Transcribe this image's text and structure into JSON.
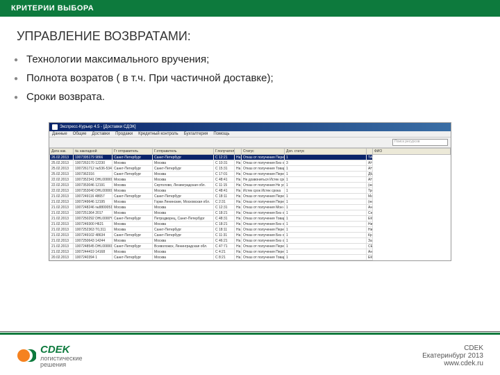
{
  "header": "КРИТЕРИИ ВЫБОРА",
  "title": "УПРАВЛЕНИЕ ВОЗВРАТАМИ:",
  "bullets": [
    "Технологии максимального вручения;",
    "Полнота возратов ( в т.ч. При частичной доставке);",
    "Сроки возврата."
  ],
  "app": {
    "title": "Экспресс-Курьер 4.5 - [Доставки СДЭК]",
    "menu": [
      "Данные",
      "Общие",
      "Доставки",
      "Продажи",
      "Кредитный контроль",
      "Бухгалтерия",
      "Помощь"
    ],
    "search_placeholder": "Поиск ресурсов"
  },
  "columns": [
    "Дата нак.",
    "№ накладной",
    "Гг отправитель",
    "Г.отправитель",
    "Г.получатель",
    "",
    "",
    "Статус",
    "Доп. статус",
    "",
    "ФИО"
  ],
  "rows": [
    {
      "date": "26.02.2013",
      "nak": "1007395179 9866",
      "otpr": "Санкт-Петербург",
      "pol": "Санкт-Петербург",
      "t": "С 12:21",
      "n": "1",
      "status": "На время, возврат",
      "dop": "Отказ от получения Перевклад",
      "n2": "1",
      "fio": "ТАТЬЯНА",
      "sel": true
    },
    {
      "date": "25.02.2013",
      "nak": "1007263170 12230",
      "otpr": "Москва",
      "pol": "Москва",
      "t": "С 10:31",
      "n": "1",
      "status": "На время, возврат",
      "dop": "Отказ от получения Без объяснения",
      "n2": "3",
      "fio": "АНДРЕЙ"
    },
    {
      "date": "25.02.2013",
      "nak": "1007261712 №536-534",
      "otpr": "Санкт-Петербург",
      "pol": "Санкт-Петербург",
      "t": "С 15:31",
      "n": "1",
      "status": "На время, возврат",
      "dop": "Отказ от получения Товар не подошел/не понравился",
      "n2": "1",
      "fio": "АНДРЕЙ"
    },
    {
      "date": "25.02.2013",
      "nak": "1007362316",
      "otpr": "Санкт-Петербург",
      "pol": "Москва",
      "t": "С 17:01",
      "n": "1",
      "status": "На время, возврат",
      "dop": "Отказ от получения Переадресат",
      "n2": "1",
      "fio": "ДМИТРИЙ"
    },
    {
      "date": "22.02.2013",
      "nak": "1007352341 DHL0000058",
      "otpr": "Москва",
      "pol": "Москва",
      "t": "С 48:41",
      "n": "1",
      "status": "На время, возврат",
      "dop": "Не дозвониться Истек срока",
      "n2": "1",
      "fio": "АНДРЕЙ"
    },
    {
      "date": "22.02.2013",
      "nak": "1007353046 12191",
      "otpr": "Москва",
      "pol": "Сертолово, Ленинградская обл.",
      "t": "С 11:15",
      "n": "1",
      "status": "На время, возврат",
      "dop": "Отказ от получения Не устроили сроки",
      "n2": "1",
      "fio": "(неуказано)"
    },
    {
      "date": "22.02.2013",
      "nak": "1007353040 DHL0000060",
      "otpr": "Москва",
      "pol": "Москва",
      "t": "С 48:41",
      "n": "1",
      "status": "На время, возврат",
      "dop": "Истек срок Истек срока",
      "n2": "1",
      "fio": "Трофим Вл."
    },
    {
      "date": "21.02.2013",
      "nak": "1007249116 48657",
      "otpr": "Санкт-Петербург",
      "pol": "Санкт-Петербург",
      "t": "С 18:11",
      "n": "1",
      "status": "На время, возврат",
      "dop": "Отказ от получения Переадресат",
      "n2": "1",
      "fio": "Мария Ша"
    },
    {
      "date": "21.02.2013",
      "nak": "1007249646 12195",
      "otpr": "Москва",
      "pol": "Горки Ленинские, Московская обл.",
      "t": "С 2:31",
      "n": "1",
      "status": "На время, возврат",
      "dop": "Отказ от получения Переадресат",
      "n2": "1",
      "fio": "(неуказано)"
    },
    {
      "date": "21.02.2013",
      "nak": "1007248246 №880005150",
      "otpr": "Москва",
      "pol": "Москва",
      "t": "С 12:31",
      "n": "1",
      "status": "На время, возврат",
      "dop": "Отказ от получения Мои суток",
      "n2": "1",
      "fio": "Андрей Ба"
    },
    {
      "date": "21.02.2013",
      "nak": "1007251364 2017",
      "otpr": "Москва",
      "pol": "Москва",
      "t": "С 18:21",
      "n": "1",
      "status": "На время, возврат",
      "dop": "Отказ от получения Без объяснения",
      "n2": "1",
      "fio": "Сергей Ка"
    },
    {
      "date": "21.02.2013",
      "nak": "1007250292 DHL0000*094",
      "otpr": "Санкт-Петербург",
      "pol": "Петродворец, Санкт-Петербург",
      "t": "С 48:31",
      "n": "1",
      "status": "На время, возврат",
      "dop": "Отказ от получения Товар не подошел/не понравился",
      "n2": "1",
      "fio": "ЕКСЕН"
    },
    {
      "date": "21.02.2013",
      "nak": "1007249300 Н621",
      "otpr": "Москва",
      "pol": "Москва",
      "t": "С 18:21",
      "n": "1",
      "status": "На время, возврат",
      "dop": "Отказ от получения Без объяснения",
      "n2": "1",
      "fio": "Николай"
    },
    {
      "date": "21.02.2013",
      "nak": "1007252363 Т0,311",
      "otpr": "Москва",
      "pol": "Санкт-Петербург",
      "t": "С 18:11",
      "n": "1",
      "status": "На время, возврат",
      "dop": "Отказ от получения Переадресат",
      "n2": "1",
      "fio": "Николай В"
    },
    {
      "date": "21.02.2013",
      "nak": "1007249102 48634",
      "otpr": "Санкт-Петербург",
      "pol": "Санкт-Петербург",
      "t": "С 11:31",
      "n": "1",
      "status": "На время, возврат",
      "dop": "Отказ от получения Без объяснения",
      "n2": "1",
      "fio": "Кристина"
    },
    {
      "date": "21.02.2013",
      "nak": "1007250643 14244",
      "otpr": "Москва",
      "pol": "Москва",
      "t": "С 46:21",
      "n": "1",
      "status": "На время, возврат",
      "dop": "Отказ от получения Без объяснения",
      "n2": "1",
      "fio": "Заралмене"
    },
    {
      "date": "21.02.2013",
      "nak": "1007248545 DHL0000052",
      "otpr": "Санкт-Петербург",
      "pol": "Всеволожск, Ленинградская обл.",
      "t": "С 47:71",
      "n": "1",
      "status": "На время, возврат",
      "dop": "Отказ от получения Переадресат",
      "n2": "1",
      "fio": "СЕМЕН"
    },
    {
      "date": "21.02.2013",
      "nak": "1007244419 14168",
      "otpr": "Москва",
      "pol": "Москва",
      "t": "С 4:21",
      "n": "1",
      "status": "На время, возврат",
      "dop": "Отказ от получения Переадресат",
      "n2": "1",
      "fio": "Андрей В"
    },
    {
      "date": "20.02.2013",
      "nak": "1007240394 1",
      "otpr": "Санкт-Петербург",
      "pol": "Москва",
      "t": "С 8:21",
      "n": "1",
      "status": "На время, возврат",
      "dop": "Отказ от получения Товар не подошел/не понравился",
      "n2": "1",
      "fio": "ЕКАТЕРИН"
    }
  ],
  "footer": {
    "brand": "CDEK",
    "tagline1": "логистические",
    "tagline2": "решения",
    "line1": "CDEK",
    "line2": "Екатеринбург 2013",
    "line3": "www.cdek.ru"
  }
}
